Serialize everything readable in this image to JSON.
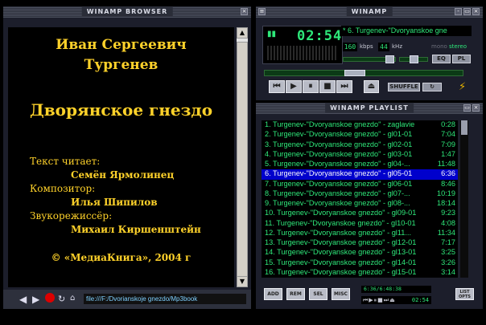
{
  "browser": {
    "title": "WINAMP BROWSER",
    "author_line1": "Иван Сергеевич",
    "author_line2": "Тургенев",
    "book_title": "Дворянское гнездо",
    "reader_label": "Текст читает:",
    "reader_name": "Семён Ярмолинец",
    "composer_label": "Композитор:",
    "composer_name": "Илья Шипилов",
    "sound_label": "Звукорежиссёр:",
    "sound_name": "Михаил Киршенштейн",
    "copyright": "© «МедиаКнига», 2004 г",
    "url": "file:///F:/Dvorianskoje gnezdo/Mp3book"
  },
  "main": {
    "title": "WINAMP",
    "time": "02:54",
    "song_ticker": "* 6. Turgenev-\"Dvoryanskoe gne",
    "kbps": "160",
    "kbps_label": "kbps",
    "khz": "44",
    "khz_label": "kHz",
    "mono_label": "mono",
    "stereo_label": "stereo",
    "eq_label": "EQ",
    "pl_label": "PL",
    "shuffle_label": "SHUFFLE",
    "seek_position": 0.45
  },
  "playlist": {
    "title": "WINAMP PLAYLIST",
    "items": [
      {
        "title": "1. Turgenev-\"Dvoryanskoe gnezdo\" - zaglavie",
        "duration": "0:28"
      },
      {
        "title": "2. Turgenev-\"Dvoryanskoe gnezdo\" - gl01-01",
        "duration": "7:04"
      },
      {
        "title": "3. Turgenev-\"Dvoryanskoe gnezdo\" - gl02-01",
        "duration": "7:09"
      },
      {
        "title": "4. Turgenev-\"Dvoryanskoe gnezdo\" - gl03-01",
        "duration": "1:47"
      },
      {
        "title": "5. Turgenev-\"Dvoryanskoe gnezdo\" - gl04-...",
        "duration": "11:48"
      },
      {
        "title": "6. Turgenev-\"Dvoryanskoe gnezdo\" - gl05-01",
        "duration": "6:36"
      },
      {
        "title": "7. Turgenev-\"Dvoryanskoe gnezdo\" - gl06-01",
        "duration": "8:46"
      },
      {
        "title": "8. Turgenev-\"Dvoryanskoe gnezdo\" - gl07-...",
        "duration": "10:19"
      },
      {
        "title": "9. Turgenev-\"Dvoryanskoe gnezdo\" - gl08-...",
        "duration": "18:14"
      },
      {
        "title": "10. Turgenev-\"Dvoryanskoe gnezdo\" - gl09-01",
        "duration": "9:23"
      },
      {
        "title": "11. Turgenev-\"Dvoryanskoe gnezdo\" - gl10-01",
        "duration": "4:08"
      },
      {
        "title": "12. Turgenev-\"Dvoryanskoe gnezdo\" - gl11...",
        "duration": "11:34"
      },
      {
        "title": "13. Turgenev-\"Dvoryanskoe gnezdo\" - gl12-01",
        "duration": "7:17"
      },
      {
        "title": "14. Turgenev-\"Dvoryanskoe gnezdo\" - gl13-01",
        "duration": "3:25"
      },
      {
        "title": "15. Turgenev-\"Dvoryanskoe gnezdo\" - gl14-01",
        "duration": "3:26"
      },
      {
        "title": "16. Turgenev-\"Dvoryanskoe gnezdo\" - gl15-01",
        "duration": "3:14"
      }
    ],
    "buttons": {
      "add": "ADD",
      "rem": "REM",
      "sel": "SEL",
      "misc": "MISC",
      "list": "LIST OPTS"
    },
    "totals": "6:36/6:48:38",
    "mini_time": "02:54"
  }
}
